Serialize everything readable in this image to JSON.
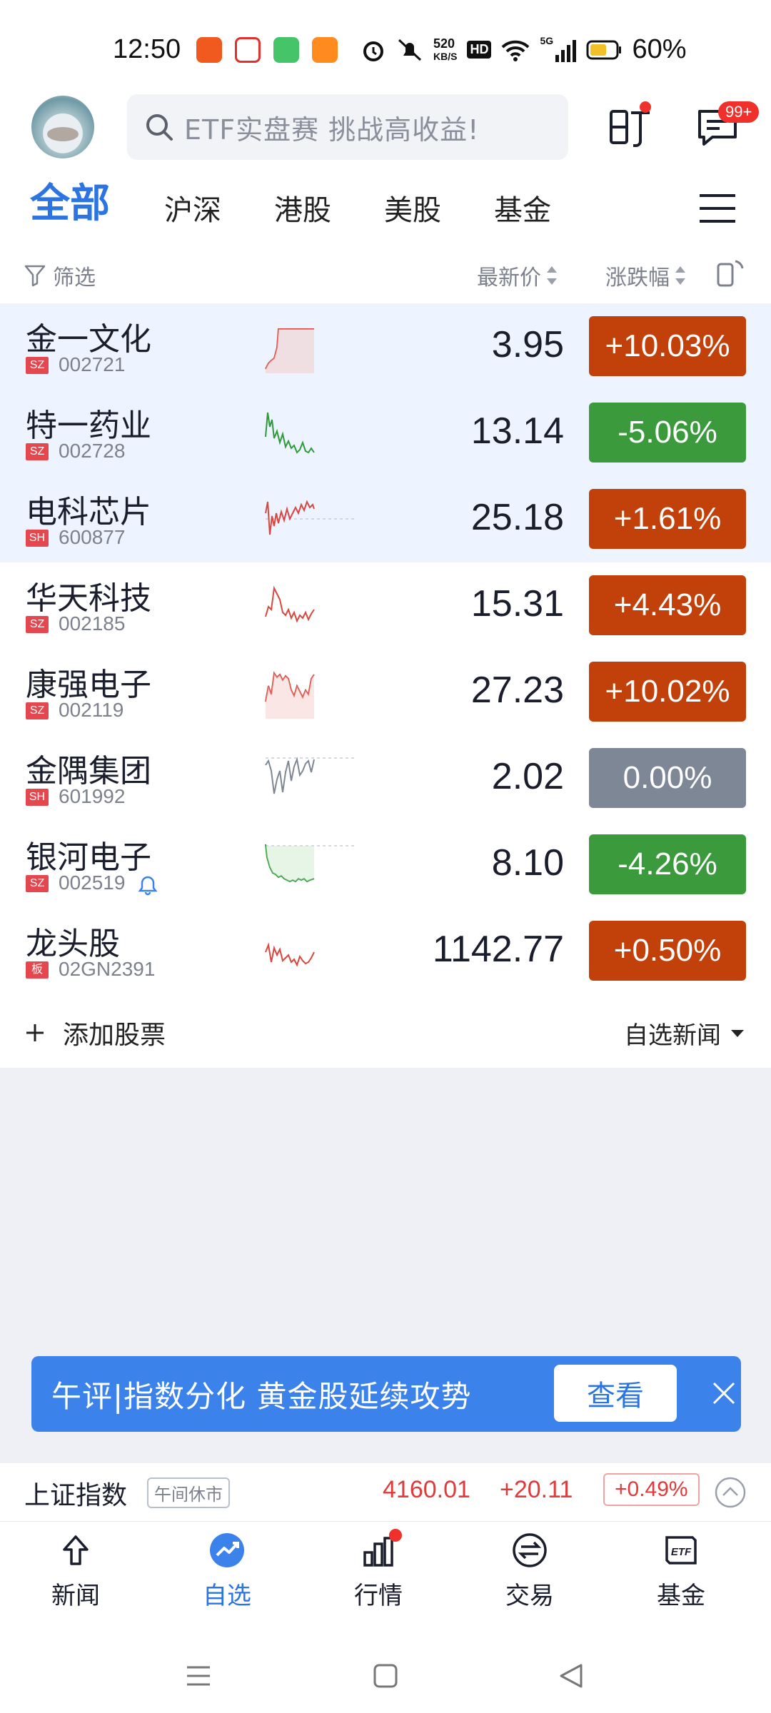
{
  "status_bar": {
    "time": "12:50",
    "net_speed_value": "520",
    "net_speed_unit": "KB/S",
    "hd_label": "HD",
    "signal_label": "5G",
    "battery": "60%"
  },
  "header": {
    "search_placeholder": "ETF实盘赛 挑战高收益!",
    "message_badge": "99+"
  },
  "tabs": [
    {
      "label": "全部"
    },
    {
      "label": "沪深"
    },
    {
      "label": "港股"
    },
    {
      "label": "美股"
    },
    {
      "label": "基金"
    }
  ],
  "filter_bar": {
    "filter_label": "筛选",
    "price_header": "最新价",
    "change_header": "涨跌幅"
  },
  "stocks": [
    {
      "name": "金一文化",
      "market": "SZ",
      "code": "002721",
      "price": "3.95",
      "change": "+10.03%",
      "trend": "up"
    },
    {
      "name": "特一药业",
      "market": "SZ",
      "code": "002728",
      "price": "13.14",
      "change": "-5.06%",
      "trend": "down"
    },
    {
      "name": "电科芯片",
      "market": "SH",
      "code": "600877",
      "price": "25.18",
      "change": "+1.61%",
      "trend": "up"
    },
    {
      "name": "华天科技",
      "market": "SZ",
      "code": "002185",
      "price": "15.31",
      "change": "+4.43%",
      "trend": "up"
    },
    {
      "name": "康强电子",
      "market": "SZ",
      "code": "002119",
      "price": "27.23",
      "change": "+10.02%",
      "trend": "up"
    },
    {
      "name": "金隅集团",
      "market": "SH",
      "code": "601992",
      "price": "2.02",
      "change": "0.00%",
      "trend": "flat"
    },
    {
      "name": "银河电子",
      "market": "SZ",
      "code": "002519",
      "price": "8.10",
      "change": "-4.26%",
      "trend": "down"
    },
    {
      "name": "龙头股",
      "market": "板",
      "code": "02GN2391",
      "price": "1142.77",
      "change": "+0.50%",
      "trend": "up"
    }
  ],
  "list_footer": {
    "add_label": "添加股票",
    "news_label": "自选新闻"
  },
  "banner": {
    "text": "午评|指数分化 黄金股延续攻势",
    "button": "查看"
  },
  "index_bar": {
    "name": "上证指数",
    "status": "午间休市",
    "value": "4160.01",
    "change": "+20.11",
    "percent": "+0.49%"
  },
  "bottom_nav": [
    {
      "label": "新闻"
    },
    {
      "label": "自选"
    },
    {
      "label": "行情"
    },
    {
      "label": "交易"
    },
    {
      "label": "基金"
    }
  ],
  "colors": {
    "accent": "#2b74e2",
    "up": "#c2410a",
    "down": "#3a9a3c",
    "flat": "#7e8795"
  }
}
